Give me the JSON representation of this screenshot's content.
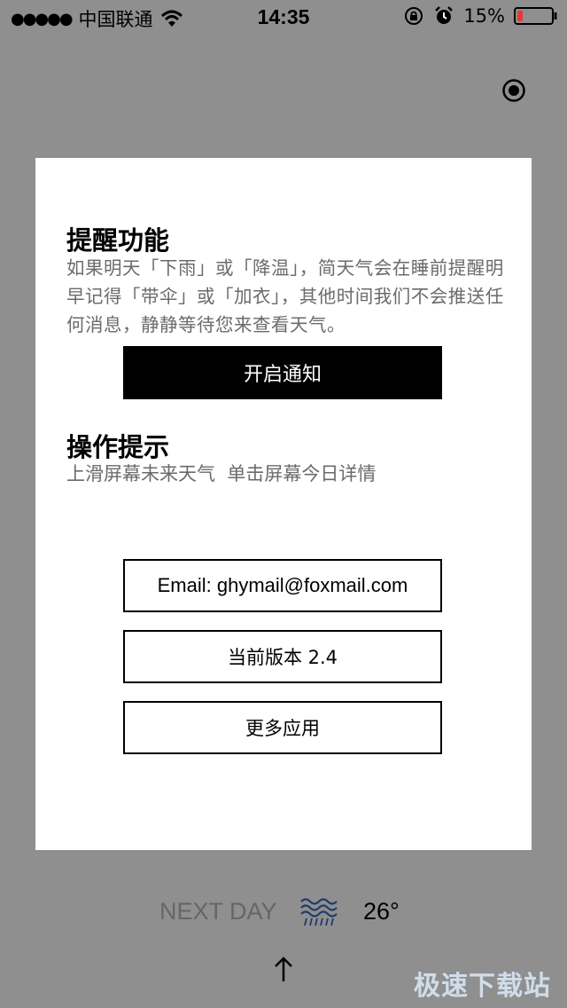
{
  "status_bar": {
    "signal_dots": "●●●●●",
    "carrier": "中国联通",
    "time": "14:35",
    "battery_percent": "15%"
  },
  "colors": {
    "overlay_bg": "#8f8f8f",
    "card_bg": "#ffffff",
    "primary_button_bg": "#000000",
    "battery_low": "#e53935",
    "body_text": "#6b6b6b"
  },
  "reminder": {
    "title": "提醒功能",
    "body": "如果明天「下雨」或「降温」，简天气会在睡前提醒明早记得「带伞」或「加衣」，其他时间我们不会推送任何消息，静静等待您来查看天气。",
    "button_label": "开启通知"
  },
  "tips": {
    "title": "操作提示",
    "body": "上滑屏幕未来天气  单击屏幕今日详情"
  },
  "buttons": {
    "email": "Email: ghymail@foxmail.com",
    "version": "当前版本  2.4",
    "more_apps": "更多应用"
  },
  "bottom": {
    "next_day_label": "NEXT DAY",
    "weather_icon": "rain-wave-icon",
    "temperature": "26°"
  },
  "watermark": "极速下载站"
}
